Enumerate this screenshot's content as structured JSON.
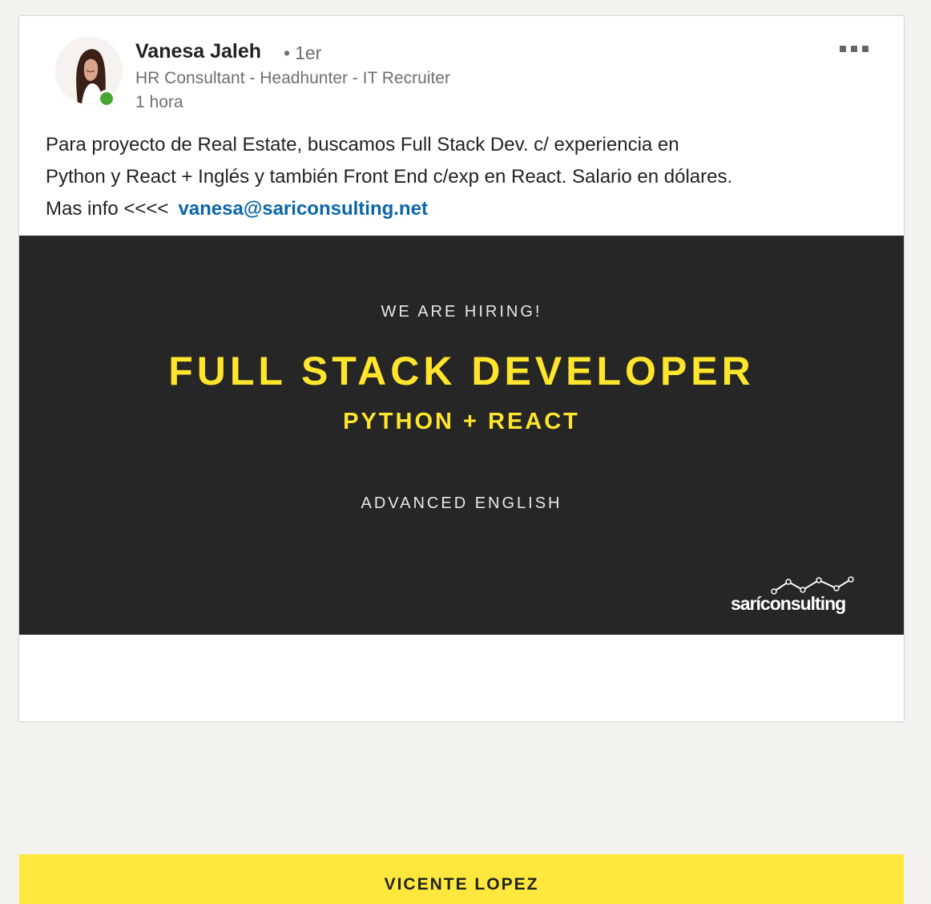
{
  "post": {
    "author": {
      "name": "Vanesa Jaleh",
      "degree": "1er",
      "degree_separator": "•",
      "headline": "HR Consultant - Headhunter - IT Recruiter",
      "time": "1 hora",
      "online": true
    },
    "more_menu_icon": "more-horizontal-icon",
    "text": {
      "line1": "Para proyecto de Real Estate, buscamos Full Stack Dev. c/ experiencia en",
      "line2": "Python y React + Inglés y también Front End c/exp en React.  Salario en dólares.",
      "line3_prefix": "Mas info <<<<",
      "email": "vanesa@sariconsulting.net"
    }
  },
  "banner": {
    "hiring_label": "WE ARE HIRING!",
    "job_title": "FULL STACK DEVELOPER",
    "job_stack": "PYTHON + REACT",
    "language_requirement": "ADVANCED ENGLISH",
    "brand_name": "saríconsulting",
    "location": "VICENTE LOPEZ",
    "colors": {
      "background": "#262626",
      "accent_yellow": "#ffe52c",
      "location_bar": "#ffe83d"
    }
  },
  "colors": {
    "link_blue": "#0a66a8",
    "presence_green": "#45a634",
    "muted_text": "#707070"
  }
}
